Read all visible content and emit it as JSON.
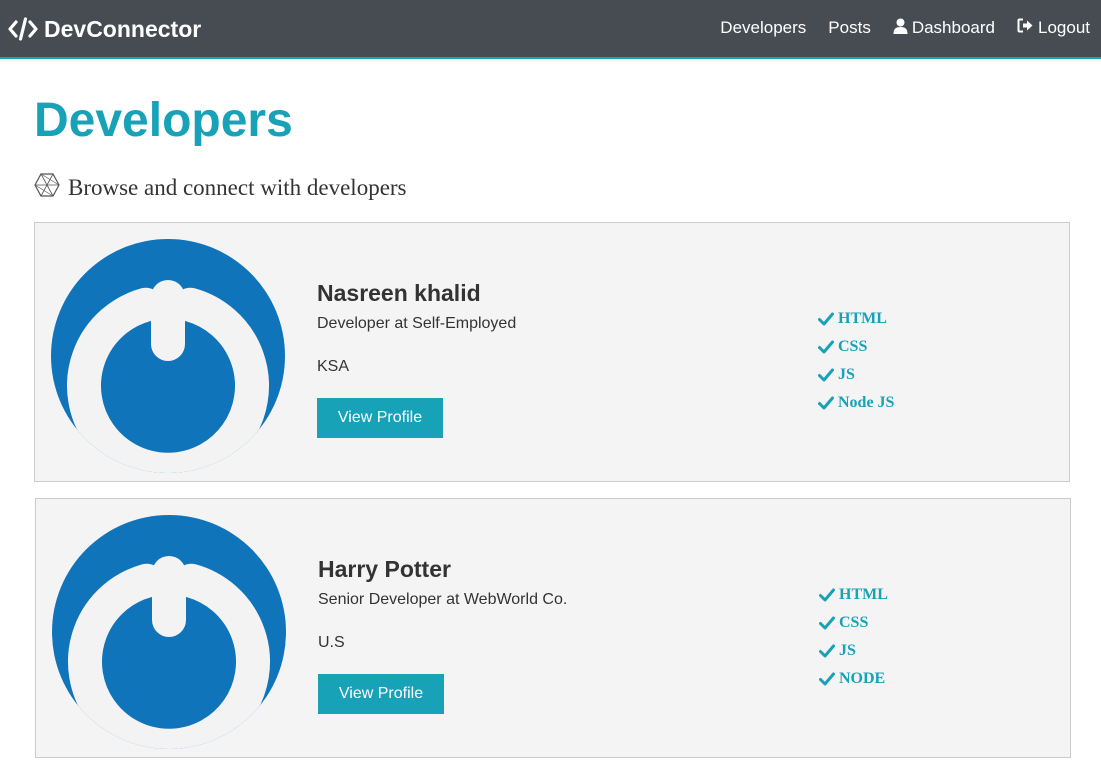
{
  "navbar": {
    "brand": "DevConnector",
    "links": [
      {
        "label": "Developers"
      },
      {
        "label": "Posts"
      },
      {
        "label": "Dashboard",
        "icon": "user-icon"
      },
      {
        "label": "Logout",
        "icon": "sign-out-icon"
      }
    ]
  },
  "page": {
    "title": "Developers",
    "lead": "Browse and connect with developers"
  },
  "profiles": [
    {
      "name": "Nasreen khalid",
      "status": "Developer at Self-Employed",
      "location": "KSA",
      "button_label": "View Profile",
      "skills": [
        "HTML",
        "CSS",
        "JS",
        "Node JS"
      ]
    },
    {
      "name": "Harry Potter",
      "status": "Senior Developer at WebWorld Co.",
      "location": "U.S",
      "button_label": "View Profile",
      "skills": [
        "HTML",
        "CSS",
        "JS",
        "NODE"
      ]
    }
  ],
  "colors": {
    "navbar_bg": "#474c53",
    "accent": "#17a2b8",
    "card_bg": "#f4f4f4",
    "avatar_bg": "#1074bb"
  }
}
